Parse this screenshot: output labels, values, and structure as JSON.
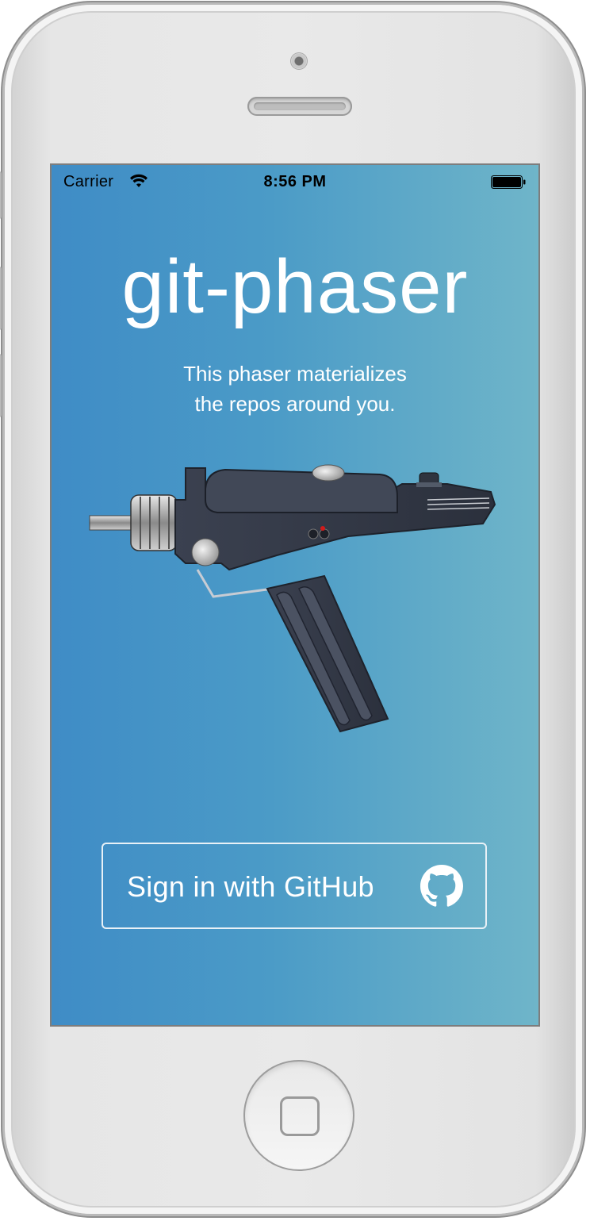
{
  "status_bar": {
    "carrier": "Carrier",
    "time": "8:56 PM",
    "icons": [
      "wifi-icon",
      "battery-icon"
    ]
  },
  "app": {
    "title": "git-phaser",
    "tagline_line1": "This phaser materializes",
    "tagline_line2": "the repos around you.",
    "illustration": "phaser-illustration"
  },
  "signin": {
    "label": "Sign in with GitHub",
    "icon": "github-icon"
  },
  "colors": {
    "gradient_start": "#3f8cc6",
    "gradient_end": "#6fb5c9",
    "text": "#ffffff"
  }
}
